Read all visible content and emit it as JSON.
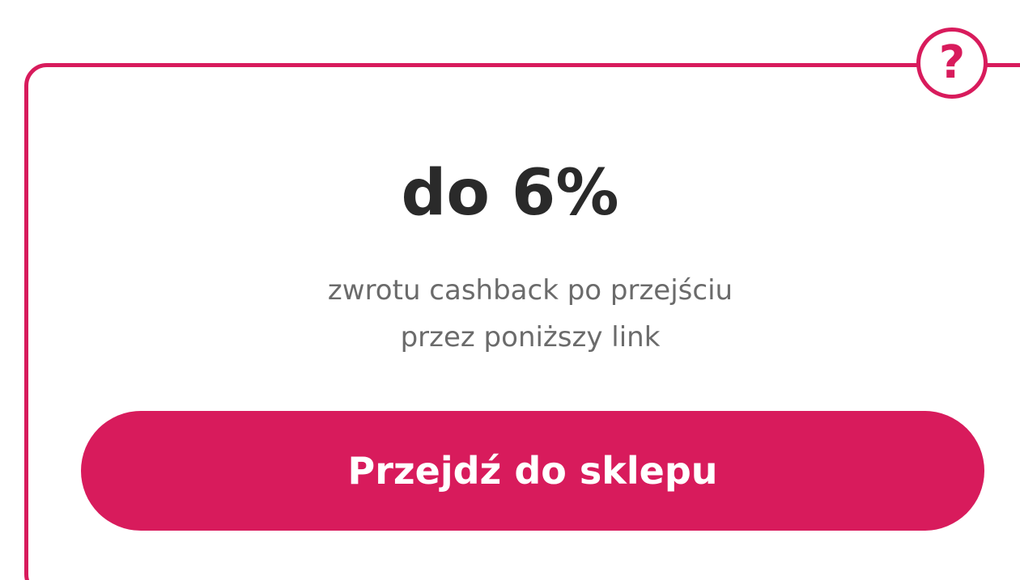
{
  "card": {
    "headline": "do 6%",
    "description_line1": "zwrotu cashback po przejściu",
    "description_line2": "przez poniższy link",
    "cta_label": "Przejdź do sklepu",
    "help_icon_glyph": "?"
  },
  "theme": {
    "accent": "#d81b5c",
    "text_dark": "#2a2a2a",
    "text_muted": "#6b6b6b",
    "background": "#ffffff"
  },
  "icons": {
    "help": "question-mark-icon"
  }
}
